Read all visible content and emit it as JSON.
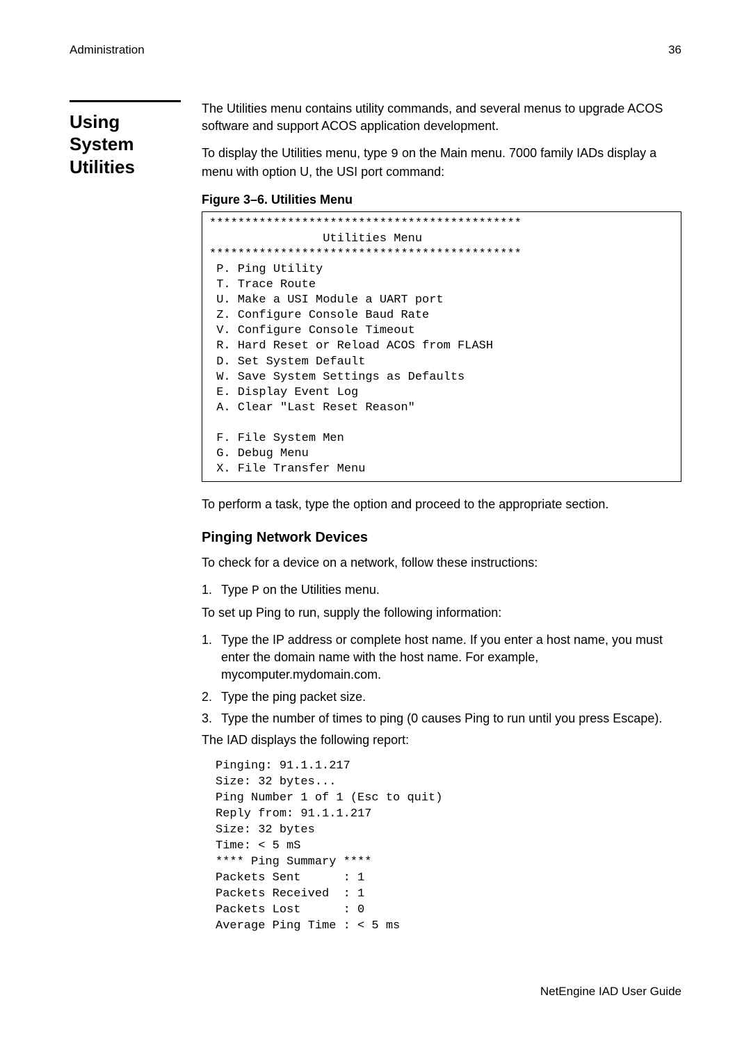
{
  "header": {
    "left": "Administration",
    "right": "36"
  },
  "section_heading": "Using System Utilities",
  "intro": {
    "p1": "The Utilities menu contains utility commands, and several menus to upgrade ACOS software and support ACOS application development.",
    "p2_a": "To display the Utilities menu, type ",
    "p2_code": "9",
    "p2_b": " on the Main menu. 7000 family IADs display a menu with option U, the USI port command:"
  },
  "figure_caption": "Figure 3–6.  Utilities Menu",
  "utilities_menu": "********************************************\n                Utilities Menu\n********************************************\n P. Ping Utility\n T. Trace Route\n U. Make a USI Module a UART port\n Z. Configure Console Baud Rate\n V. Configure Console Timeout\n R. Hard Reset or Reload ACOS from FLASH\n D. Set System Default\n W. Save System Settings as Defaults\n E. Display Event Log\n A. Clear \"Last Reset Reason\"\n\n F. File System Men\n G. Debug Menu\n X. File Transfer Menu",
  "after_menu": "To perform a task, type the option and proceed to the appropriate section.",
  "sub1_heading": "Pinging Network Devices",
  "sub1_intro": "To check for a device on a network, follow these instructions:",
  "sub1_step1_num": "1.",
  "sub1_step1_a": "Type ",
  "sub1_step1_code": "P",
  "sub1_step1_b": " on the Utilities menu.",
  "sub1_supply": "To set up Ping to run, supply the following information:",
  "sub1_s1_num": "1.",
  "sub1_s1": "Type the IP address or complete host name. If you enter a host name, you must enter the domain name with the host name. For example, mycomputer.mydomain.com.",
  "sub1_s2_num": "2.",
  "sub1_s2": "Type the ping packet size.",
  "sub1_s3_num": "3.",
  "sub1_s3": "Type the number of times to ping (0 causes Ping to run until you press Escape).",
  "sub1_report_intro": "The IAD displays the following report:",
  "ping_report": "Pinging: 91.1.1.217\nSize: 32 bytes...\nPing Number 1 of 1 (Esc to quit)\nReply from: 91.1.1.217\nSize: 32 bytes\nTime: < 5 mS\n**** Ping Summary ****\nPackets Sent      : 1\nPackets Received  : 1\nPackets Lost      : 0\nAverage Ping Time : < 5 ms",
  "footer": "NetEngine IAD User Guide"
}
